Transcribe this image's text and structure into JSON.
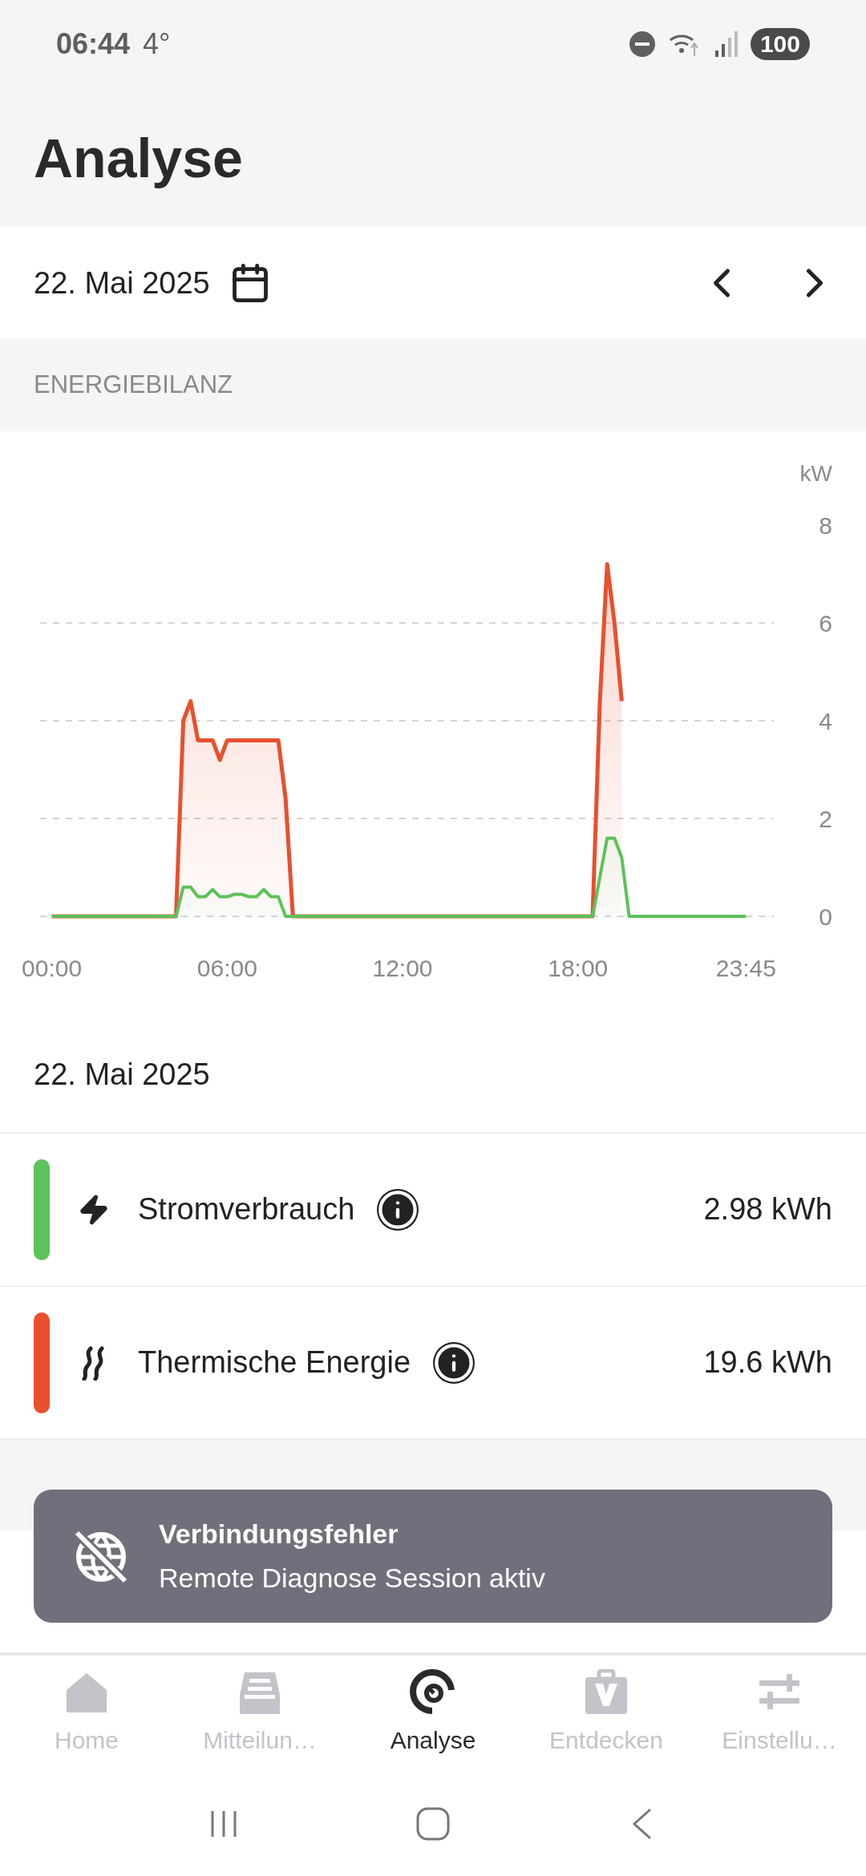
{
  "status_bar": {
    "time": "06:44",
    "temperature": "4°",
    "battery": "100"
  },
  "header": {
    "title": "Analyse"
  },
  "date_bar": {
    "date": "22. Mai 2025"
  },
  "energy_section": {
    "heading": "ENERGIEBILANZ",
    "chart_data": {
      "type": "area",
      "ylabel": "kW",
      "x": [
        0,
        4.25,
        4.5,
        4.75,
        5,
        5.25,
        5.5,
        5.75,
        6,
        6.25,
        6.5,
        6.75,
        7,
        7.25,
        7.5,
        7.75,
        8,
        8.25,
        18.5,
        18.75,
        19,
        19.25,
        19.5,
        19.75,
        23.75
      ],
      "series": [
        {
          "color": "#e8502e",
          "values": [
            0,
            0,
            4.0,
            4.4,
            3.6,
            3.6,
            3.6,
            3.2,
            3.6,
            3.6,
            3.6,
            3.6,
            3.6,
            3.6,
            3.6,
            3.6,
            2.4,
            0,
            0,
            4.4,
            7.2,
            6.0,
            4.4,
            null,
            null
          ]
        },
        {
          "color": "#5cc25a",
          "values": [
            0,
            0,
            0.6,
            0.6,
            0.4,
            0.4,
            0.55,
            0.4,
            0.4,
            0.45,
            0.45,
            0.4,
            0.4,
            0.55,
            0.4,
            0.4,
            0,
            0,
            0,
            0.8,
            1.6,
            1.6,
            1.2,
            0,
            0
          ]
        }
      ],
      "xlim": [
        -0.4,
        24.7
      ],
      "ylim": [
        0,
        8
      ],
      "grid": true,
      "xticks": [
        {
          "value": 0,
          "label": "00:00"
        },
        {
          "value": 6,
          "label": "06:00"
        },
        {
          "value": 12,
          "label": "12:00"
        },
        {
          "value": 18,
          "label": "18:00"
        },
        {
          "value": 23.75,
          "label": "23:45"
        }
      ],
      "yticks": [
        0,
        2,
        4,
        6,
        8
      ]
    }
  },
  "summary": {
    "date": "22. Mai 2025",
    "rows": [
      {
        "kind": "power",
        "label": "Stromverbrauch",
        "value": "2.98 kWh",
        "color": "#5cc25a"
      },
      {
        "kind": "heat",
        "label": "Thermische Energie",
        "value": "19.6 kWh",
        "color": "#e8502e"
      }
    ]
  },
  "toast": {
    "title": "Verbindungsfehler",
    "message": "Remote Diagnose Session aktiv"
  },
  "bottom_nav": [
    {
      "kind": "home",
      "label": "Home",
      "selected": false
    },
    {
      "kind": "inbox",
      "label": "Mitteilun…",
      "selected": false
    },
    {
      "kind": "analysis",
      "label": "Analyse",
      "selected": true
    },
    {
      "kind": "discover",
      "label": "Entdecken",
      "selected": false
    },
    {
      "kind": "settings",
      "label": "Einstellu…",
      "selected": false
    }
  ]
}
